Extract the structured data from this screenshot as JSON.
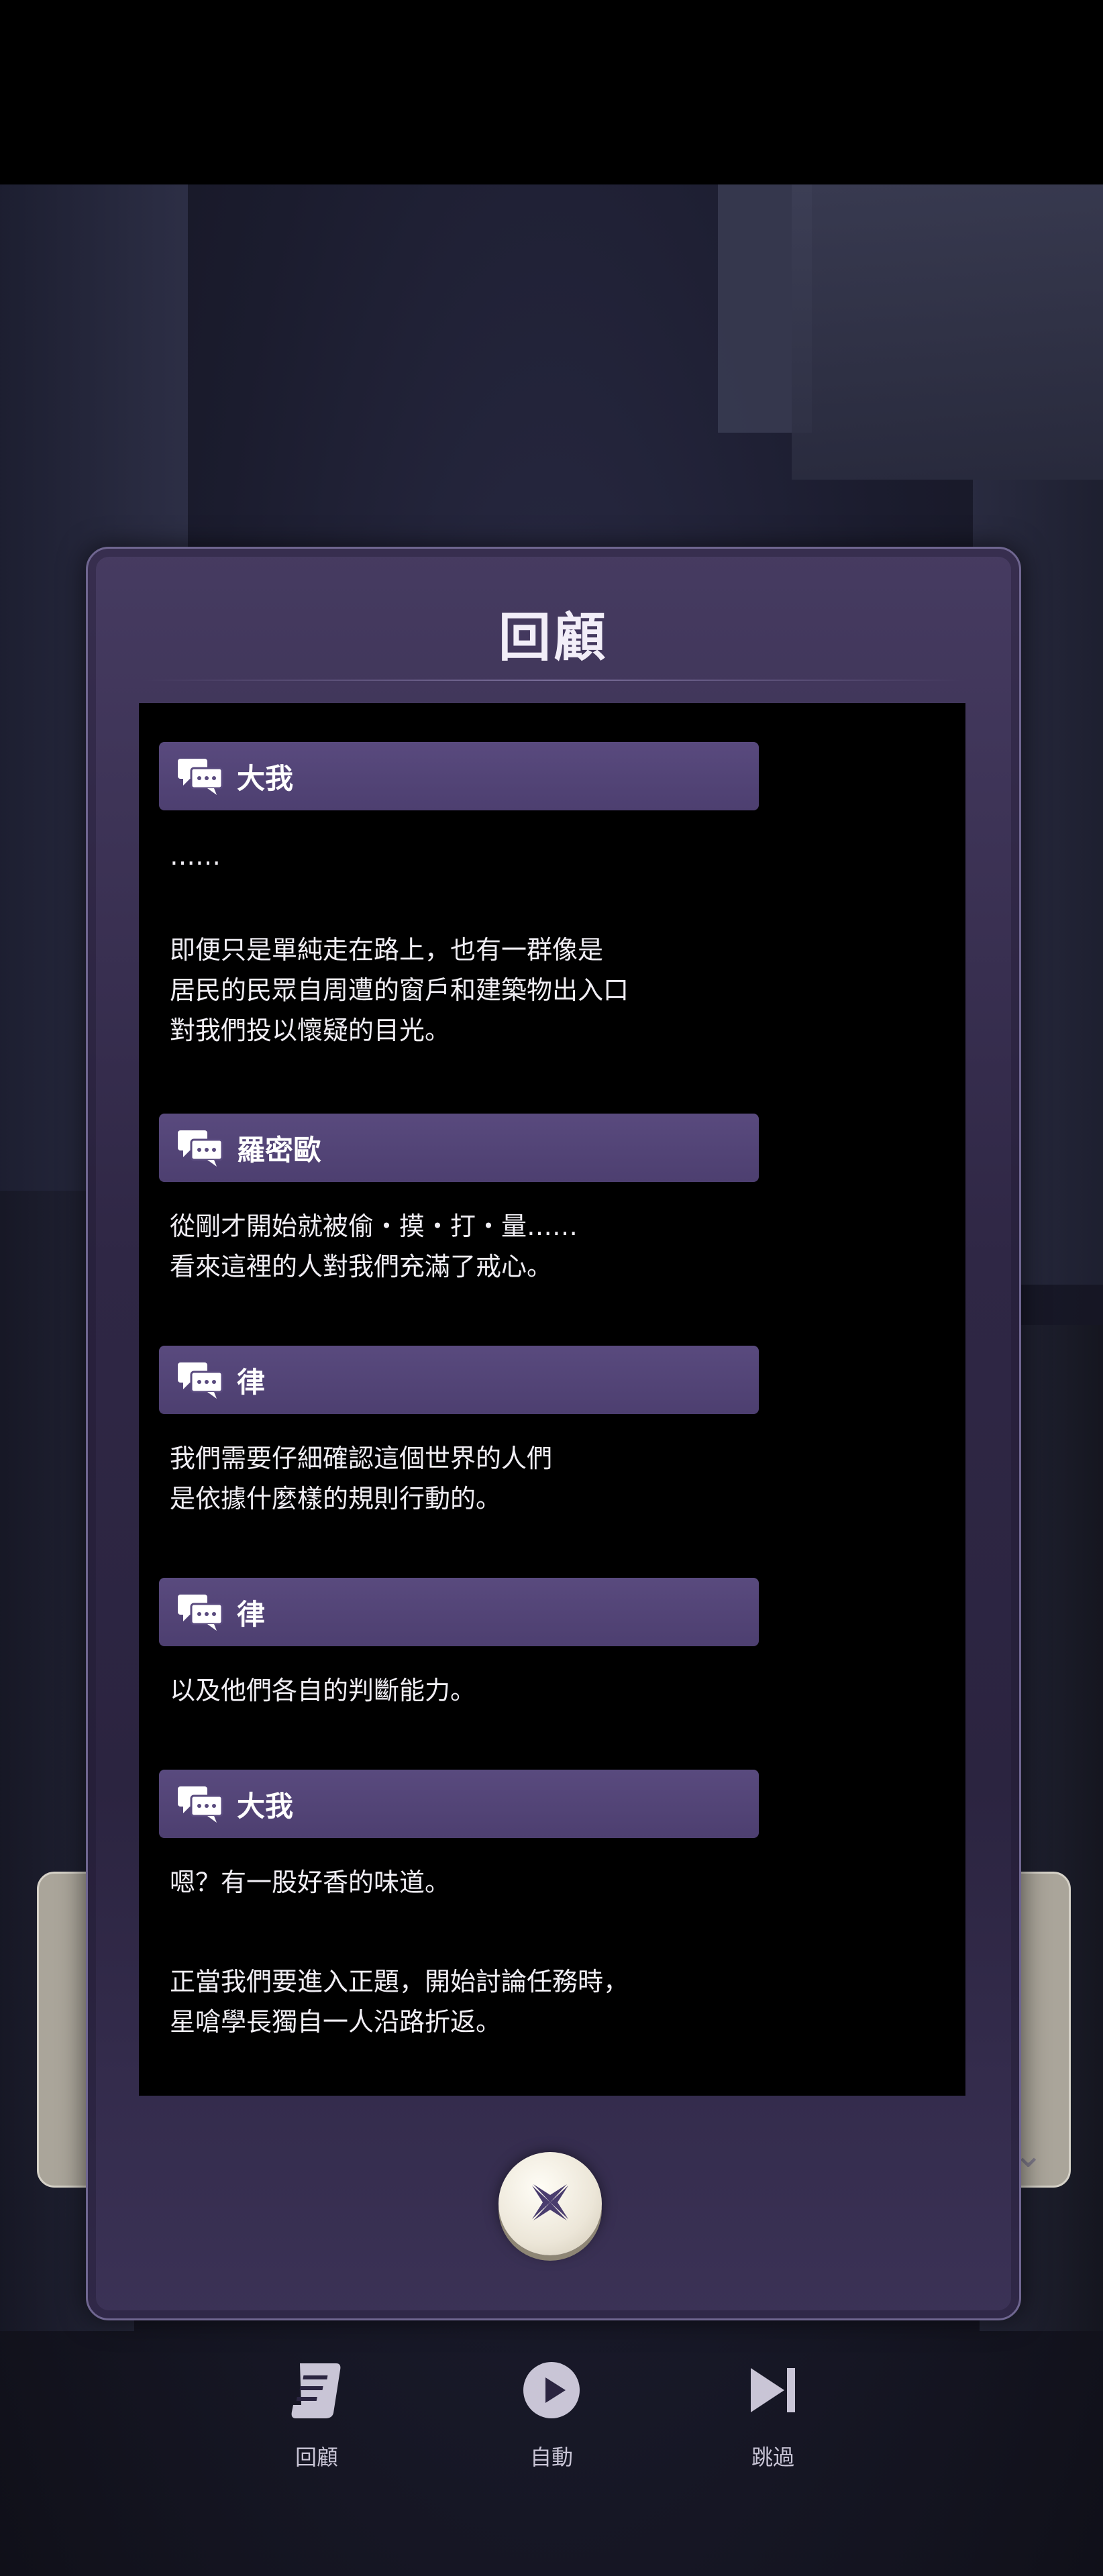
{
  "dialog": {
    "title": "回顧",
    "entries": [
      {
        "speaker": "大我",
        "lines": [
          "……",
          "",
          "即便只是單純走在路上，也有一群像是",
          "居民的民眾自周遭的窗戶和建築物出入口",
          "對我們投以懷疑的目光。"
        ]
      },
      {
        "speaker": "羅密歐",
        "lines": [
          "從剛才開始就被偷・摸・打・量……",
          "看來這裡的人對我們充滿了戒心。"
        ]
      },
      {
        "speaker": "律",
        "lines": [
          "我們需要仔細確認這個世界的人們",
          "是依據什麼樣的規則行動的。"
        ]
      },
      {
        "speaker": "律",
        "lines": [
          "以及他們各自的判斷能力。"
        ]
      },
      {
        "speaker": "大我",
        "lines": [
          "嗯？有一股好香的味道。",
          "",
          "正當我們要進入正題，開始討論任務時，",
          "星嗆學長獨自一人沿路折返。"
        ]
      }
    ]
  },
  "bottom_bar": {
    "backlog_label": "回顧",
    "auto_label": "自動",
    "skip_label": "跳過"
  },
  "colors": {
    "name_bar": "#594a7e",
    "modal_bg": "#2f2745",
    "log_bg": "#000000"
  }
}
